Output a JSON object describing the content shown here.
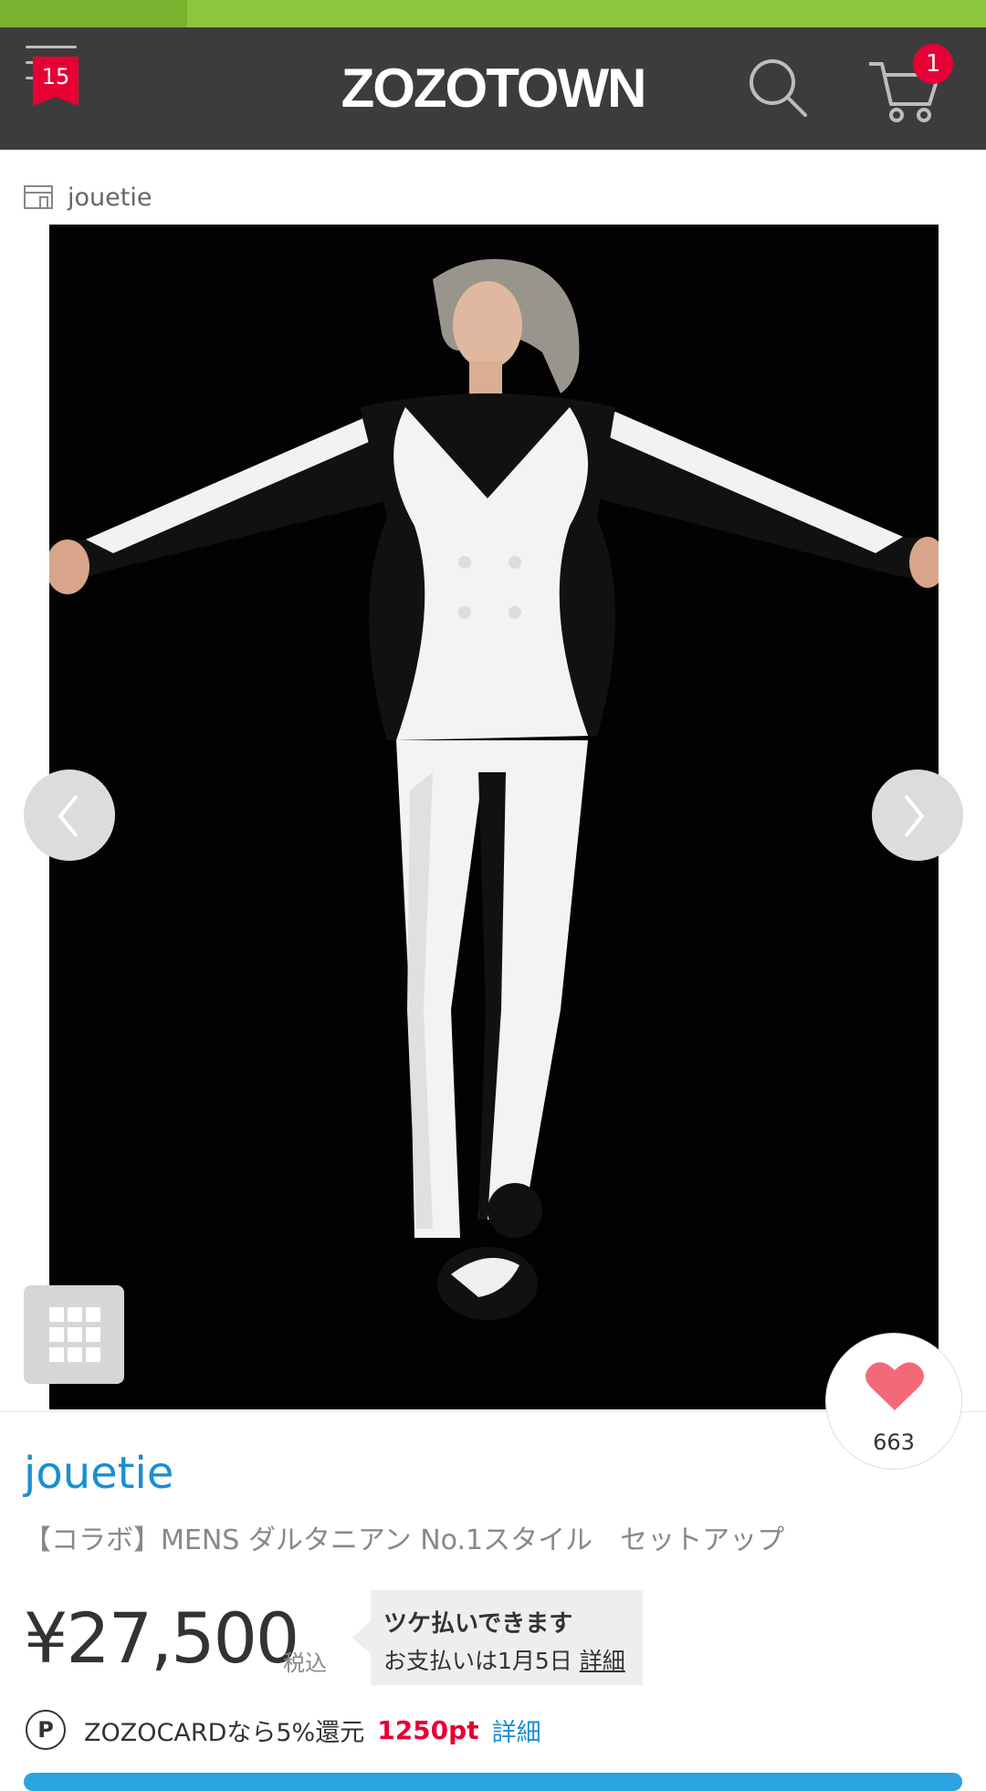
{
  "header": {
    "logo": "ZOZOTOWN",
    "menu_badge": "15",
    "cart_badge": "1",
    "menu_icon": "hamburger-menu-icon",
    "search_icon": "search-icon",
    "cart_icon": "cart-icon",
    "background": "#3c3c3c"
  },
  "shop": {
    "icon": "shop-icon",
    "name": "jouetie"
  },
  "gallery": {
    "prev_icon": "chevron-left-icon",
    "next_icon": "chevron-right-icon",
    "grid_icon": "grid-icon"
  },
  "favorite": {
    "icon": "heart-icon",
    "count": "663",
    "color": "#f26a78"
  },
  "product": {
    "brand": "jouetie",
    "name": "【コラボ】MENS ダルタニアン No.1スタイル　セットアップ",
    "price": "¥27,500",
    "tax_label": "税込",
    "brand_color": "#1a8fd0"
  },
  "payment": {
    "title": "ツケ払いできます",
    "sub_text": "お支払いは1月5日 ",
    "detail_link": "詳細"
  },
  "points": {
    "icon_label": "P",
    "text": "ZOZOCARDなら5%還元",
    "points": "1250pt",
    "detail_link": "詳細",
    "accent": "#e60033"
  }
}
